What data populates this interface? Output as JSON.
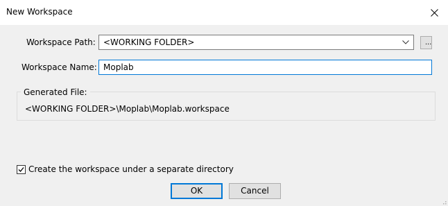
{
  "dialog": {
    "title": "New Workspace",
    "close_icon": "close-icon"
  },
  "form": {
    "path_label": "Workspace Path:",
    "path_value": "<WORKING FOLDER>",
    "browse_label": "...",
    "name_label": "Workspace Name:",
    "name_value": "Moplab"
  },
  "generated": {
    "title": "Generated File:",
    "value": "<WORKING FOLDER>\\Moplab\\Moplab.workspace"
  },
  "options": {
    "separate_dir_label": "Create the workspace under a separate directory",
    "separate_dir_checked": true
  },
  "buttons": {
    "ok_label": "OK",
    "cancel_label": "Cancel"
  },
  "colors": {
    "focus_border": "#0078d7",
    "dialog_background": "#f0f0f0",
    "title_background": "#ffffff"
  }
}
